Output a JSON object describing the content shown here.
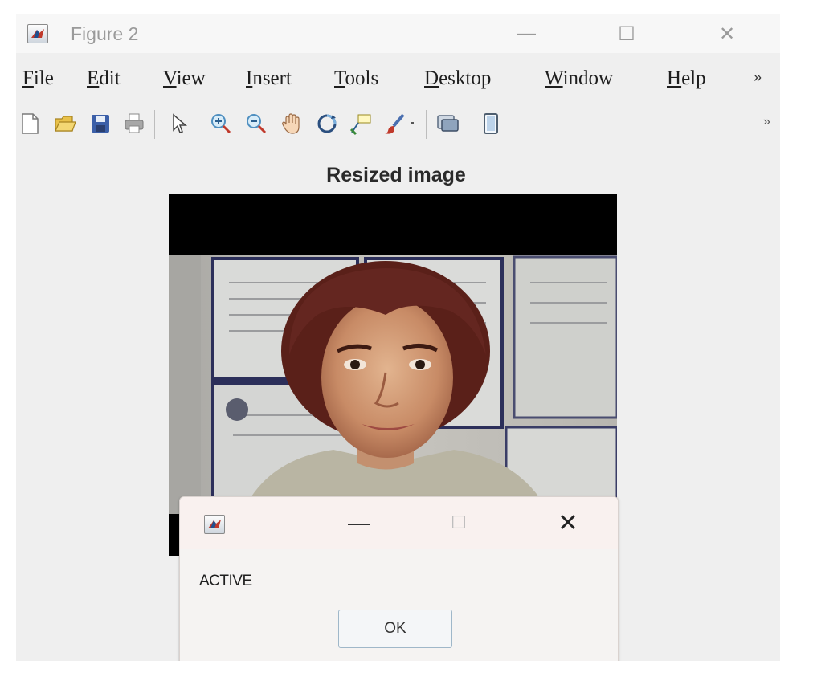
{
  "window": {
    "title": "Figure 2",
    "controls": {
      "minimize": "—",
      "maximize": "☐",
      "close": "✕"
    }
  },
  "menu": {
    "items": [
      {
        "mnemonic": "F",
        "rest": "ile"
      },
      {
        "mnemonic": "E",
        "rest": "dit"
      },
      {
        "mnemonic": "V",
        "rest": "iew"
      },
      {
        "mnemonic": "I",
        "rest": "nsert"
      },
      {
        "mnemonic": "T",
        "rest": "ools"
      },
      {
        "mnemonic": "D",
        "rest": "esktop"
      },
      {
        "mnemonic": "W",
        "rest": "indow"
      },
      {
        "mnemonic": "H",
        "rest": "elp"
      }
    ],
    "overflow": "»"
  },
  "toolbar": {
    "items": [
      "new-figure-icon",
      "open-file-icon",
      "save-icon",
      "print-icon",
      "select-pointer-icon",
      "zoom-in-icon",
      "zoom-out-icon",
      "pan-hand-icon",
      "rotate-3d-icon",
      "data-cursor-icon",
      "brush-icon",
      "dropdown-arrow-icon",
      "link-plot-icon",
      "insert-colorbar-icon"
    ],
    "overflow": "»"
  },
  "axes": {
    "title": "Resized image"
  },
  "dialog": {
    "controls": {
      "minimize": "—",
      "maximize": "☐",
      "close": "✕"
    },
    "message": "ACTIVE",
    "ok_label": "OK"
  },
  "colors": {
    "window_bg": "#efefef",
    "dialog_bg": "#f5f3f2",
    "ok_border": "#9fb7c9"
  }
}
